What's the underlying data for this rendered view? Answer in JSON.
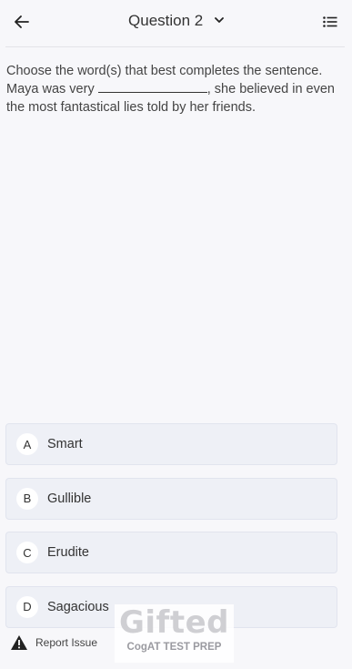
{
  "header": {
    "title": "Question 2",
    "back_icon": "arrow-left-icon",
    "dropdown_icon": "chevron-down-icon",
    "list_icon": "list-icon"
  },
  "question": {
    "instruction": "Choose the word(s) that best completes the sentence.",
    "sentence_start": "Maya was very",
    "sentence_end": ", she believed in even the most fantastical lies told by her friends."
  },
  "options": [
    {
      "letter": "A",
      "text": "Smart"
    },
    {
      "letter": "B",
      "text": "Gullible"
    },
    {
      "letter": "C",
      "text": "Erudite"
    },
    {
      "letter": "D",
      "text": "Sagacious"
    }
  ],
  "report": {
    "label": "Report Issue",
    "icon": "warning-icon"
  },
  "watermark": {
    "brand": "Gifted",
    "tagline": "CogAT TEST PREP"
  }
}
